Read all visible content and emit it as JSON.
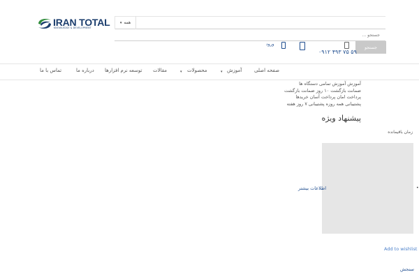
{
  "header": {
    "logo_text": "IRAN TOTAL",
    "logo_tagline": "KNOWLEDGE & DEVELOPMENT",
    "search": {
      "category_label": "همه",
      "placeholder": "جستجو ...",
      "button_label": "جستجو"
    },
    "phone": "۰۹۱۲ ۴۹۳ ۷۵ ۵۹",
    "login_label": "ورود"
  },
  "nav": {
    "items": [
      {
        "label": "صفحه اصلی"
      },
      {
        "label": "آموزش"
      },
      {
        "label": "محصولات"
      },
      {
        "label": "مقالات"
      },
      {
        "label": "توسعه نرم افزارها"
      },
      {
        "label": "درباره ما"
      },
      {
        "label": "تماس با ما"
      }
    ]
  },
  "content": {
    "info_lines": [
      "آموزش آموزش تمامی دستگاه ها",
      "ضمانت بازگشت ۱۰ روز ضمانت بازگشت",
      "پرداخت امان پرداخت آسان خریدها",
      "پشتیبانی همه روزه پشتیبانی ۷ روز هفته"
    ],
    "special_offer_title": "پیشنهاد ویژه",
    "time_left_label": "زمان باقیمانده",
    "more_info_label": "اطلاعات بیشتر",
    "wishlist_label": "Add to wishlist",
    "compare_label": "سنجش"
  }
}
